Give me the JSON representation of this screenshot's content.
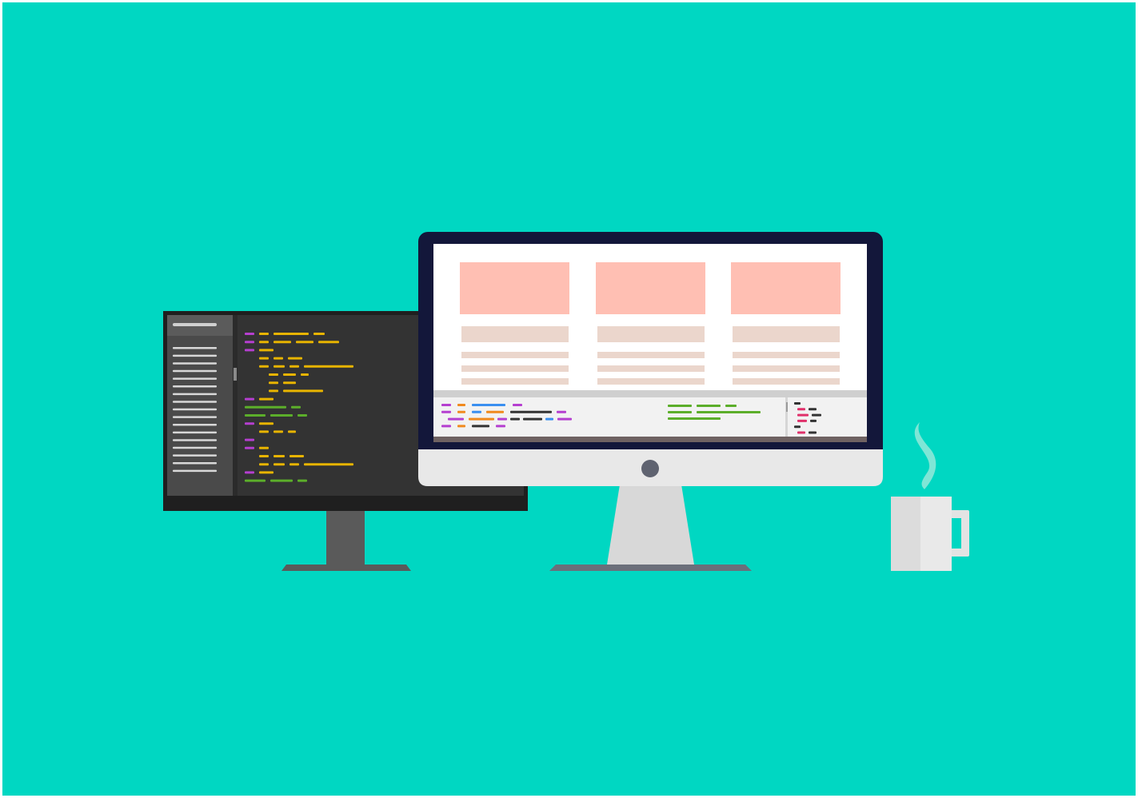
{
  "scene": {
    "description_free": true,
    "colors": {
      "background": "#00d7c2",
      "frame_border": "#ffffff",
      "dark_monitor_body": "#1f1f1f",
      "dark_monitor_screen": "#333333",
      "dark_monitor_sidebar": "#4a4a4a",
      "dark_monitor_stand": "#5a5a5a",
      "imac_bezel": "#13173a",
      "imac_chin": "#e8e8e8",
      "imac_screen": "#f7f7f7",
      "imac_stand": "#d8d8d8",
      "imac_base": "#6b6f7a",
      "card_image": "#ffbfb3",
      "card_text": "#ebd6cc",
      "code_purple": "#b53fd0",
      "code_yellow": "#e8b400",
      "code_green": "#5cae2a",
      "code_blue": "#3a8ff0",
      "code_orange": "#f08a1e",
      "code_black": "#333333",
      "code_pink": "#e0306a",
      "mug": "#e9e9e9",
      "steam": "#7fe6d6"
    },
    "icons": [
      "desktop-monitor-icon",
      "imac-icon",
      "coffee-mug-icon",
      "steam-icon"
    ]
  }
}
